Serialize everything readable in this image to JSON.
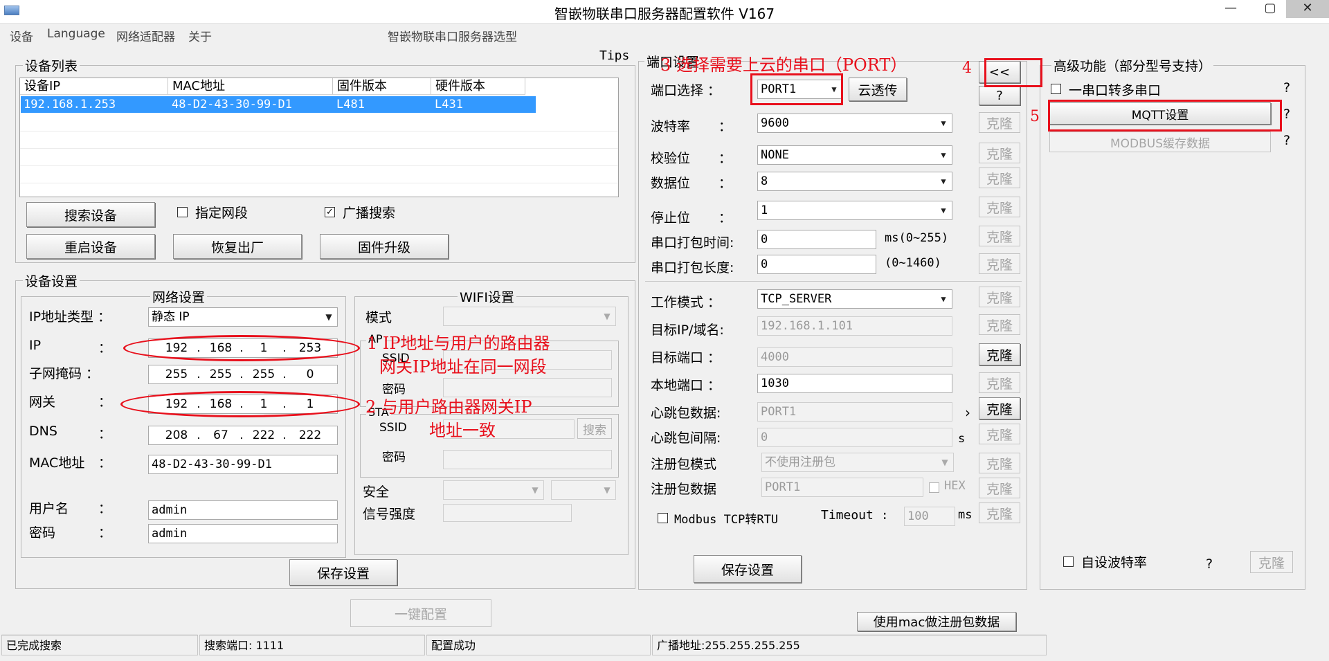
{
  "window": {
    "title": "智嵌物联串口服务器配置软件   V167",
    "min_label": "—",
    "max_label": "▢",
    "close_label": "✕"
  },
  "menu": {
    "items": [
      "设备",
      "Language",
      "网络适配器",
      "关于"
    ],
    "center": "智嵌物联串口服务器选型"
  },
  "device_list": {
    "legend": "设备列表",
    "columns": [
      "设备IP",
      "MAC地址",
      "固件版本",
      "硬件版本"
    ],
    "rows": [
      {
        "ip": "192.168.1.253",
        "mac": "48-D2-43-30-99-D1",
        "firmware": "L481",
        "hardware": "L431"
      }
    ],
    "search_btn": "搜索设备",
    "reboot_btn": "重启设备",
    "factory_btn": "恢复出厂",
    "upgrade_btn": "固件升级",
    "specify_segment": "指定网段",
    "broadcast_search": "广播搜索",
    "broadcast_checked": true
  },
  "device_settings": {
    "legend": "设备设置",
    "network": {
      "legend": "网络设置",
      "ip_type_label": "IP地址类型 ：",
      "ip_type_value": "静态 IP",
      "ip_label": "IP",
      "ip": [
        "192",
        "168",
        "1",
        "253"
      ],
      "mask_label": "子网掩码 ：",
      "mask": [
        "255",
        "255",
        "255",
        "0"
      ],
      "gateway_label": "网关",
      "gateway": [
        "192",
        "168",
        "1",
        "1"
      ],
      "dns_label": "DNS",
      "dns": [
        "208",
        "67",
        "222",
        "222"
      ],
      "mac_label": "MAC地址",
      "mac": "48-D2-43-30-99-D1",
      "user_label": "用户名",
      "user": "admin",
      "pwd_label": "密码",
      "pwd": "admin",
      "colon": "："
    },
    "wifi": {
      "legend": "WIFI设置",
      "mode_label": "模式",
      "ap_label": "AP",
      "ssid_label": "SSID",
      "pwd_label": "密码",
      "sta_label": "STA",
      "search_btn": "搜索",
      "security_label": "安全",
      "signal_label": "信号强度"
    },
    "save_btn": "保存设置"
  },
  "one_key_btn": "一键配置",
  "tips": "Tips",
  "port": {
    "legend": "端口设置",
    "port_select_label": "端口选择 ：",
    "port_value": "PORT1",
    "cloud_btn": "云透传",
    "help": "?",
    "baud_label": "波特率",
    "baud": "9600",
    "parity_label": "校验位",
    "parity": "NONE",
    "databits_label": "数据位",
    "databits": "8",
    "stopbits_label": "停止位",
    "stopbits": "1",
    "pack_time_label": "串口打包时间:",
    "pack_time": "0",
    "pack_time_unit": "ms(0~255)",
    "pack_len_label": "串口打包长度:",
    "pack_len": "0",
    "pack_len_unit": "(0~1460)",
    "work_mode_label": "工作模式 ：",
    "work_mode": "TCP_SERVER",
    "target_ip_label": "目标IP/域名:",
    "target_ip": "192.168.1.101",
    "target_port_label": "目标端口 ：",
    "target_port": "4000",
    "local_port_label": "本地端口 ：",
    "local_port": "1030",
    "heartbeat_label": "心跳包数据:",
    "heartbeat": "PORT1",
    "heartbeat_arrow": "›",
    "heartbeat_interval_label": "心跳包间隔:",
    "heartbeat_interval": "0",
    "seconds_unit": "s",
    "reg_mode_label": "注册包模式",
    "reg_mode": "不使用注册包",
    "reg_data_label": "注册包数据",
    "reg_data": "PORT1",
    "hex_label": "HEX",
    "modbus_label": "Modbus TCP转RTU",
    "timeout_label": "Timeout :",
    "timeout": "100",
    "timeout_unit": "ms",
    "clone_label": "克隆",
    "colon": "：",
    "save_btn": "保存设置",
    "collapse_btn": "<<",
    "mac_reg_btn": "使用mac做注册包数据"
  },
  "advanced": {
    "legend": "高级功能（部分型号支持）",
    "serial_multi": "一串口转多串口",
    "mqtt_btn": "MQTT设置",
    "modbus_cache_btn": "MODBUS缓存数据",
    "custom_baud": "自设波特率",
    "help": "?",
    "clone_label": "克隆"
  },
  "status": {
    "pane1": "已完成搜索",
    "pane2": "搜索端口: 1111",
    "pane3": "配置成功",
    "pane4": "广播地址:255.255.255.255"
  },
  "annotations": {
    "a1_line1": "1  IP地址与用户的路由器",
    "a1_line2": "网关IP地址在同一网段",
    "a2_line1": "2  与用户路由器网关IP",
    "a2_line2": "地址一致",
    "a3": "3 选择需要上云的串口（PORT）",
    "a4": "4",
    "a5": "5"
  },
  "colors": {
    "selection": "#3399ff",
    "annotation": "#e8101c"
  }
}
